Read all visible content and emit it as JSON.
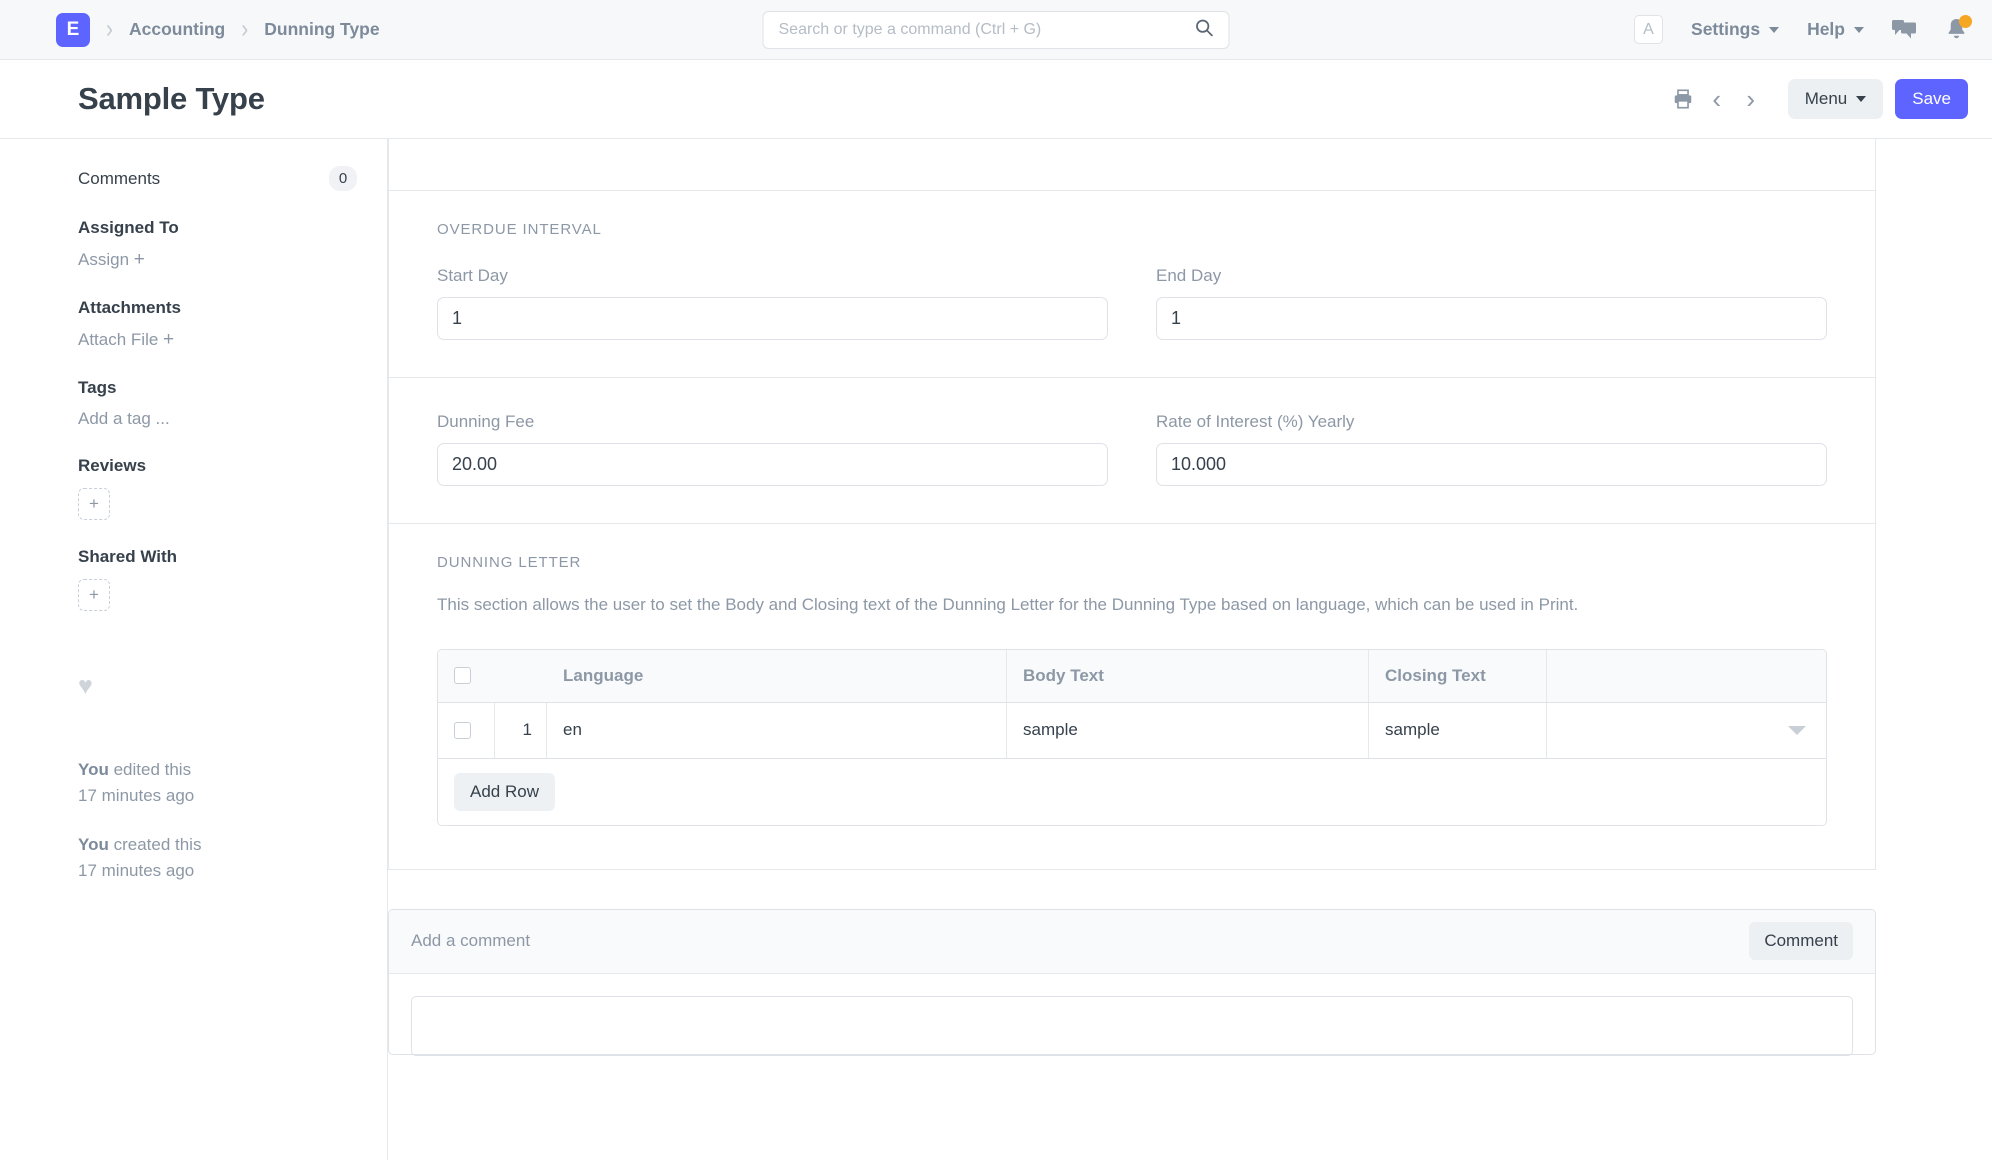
{
  "navbar": {
    "logo_letter": "E",
    "breadcrumbs": [
      "Accounting",
      "Dunning Type"
    ],
    "search_placeholder": "Search or type a command (Ctrl + G)",
    "search_value": "",
    "avatar_letter": "A",
    "settings_label": "Settings",
    "help_label": "Help"
  },
  "titlebar": {
    "title": "Sample Type",
    "menu_label": "Menu",
    "save_label": "Save"
  },
  "sidebar": {
    "comments_label": "Comments",
    "comments_count": "0",
    "assigned_to_label": "Assigned To",
    "assign_label": "Assign",
    "assign_plus": "+",
    "attachments_label": "Attachments",
    "attach_file_label": "Attach File",
    "attach_plus": "+",
    "tags_label": "Tags",
    "add_tag_label": "Add a tag ...",
    "reviews_label": "Reviews",
    "reviews_add": "+",
    "shared_with_label": "Shared With",
    "shared_add": "+",
    "activity": [
      {
        "who": "You",
        "what": " edited this",
        "when": "17 minutes ago"
      },
      {
        "who": "You",
        "what": " created this",
        "when": "17 minutes ago"
      }
    ]
  },
  "form": {
    "overdue_interval": {
      "section_label": "OVERDUE INTERVAL",
      "start_day_label": "Start Day",
      "start_day_value": "1",
      "end_day_label": "End Day",
      "end_day_value": "1"
    },
    "fees": {
      "dunning_fee_label": "Dunning Fee",
      "dunning_fee_value": "20.00",
      "rate_of_interest_label": "Rate of Interest (%) Yearly",
      "rate_of_interest_value": "10.000"
    },
    "dunning_letter": {
      "section_label": "DUNNING LETTER",
      "description": "This section allows the user to set the Body and Closing text of the Dunning Letter for the Dunning Type based on language, which can be used in Print.",
      "grid": {
        "columns": [
          "Language",
          "Body Text",
          "Closing Text"
        ],
        "rows": [
          {
            "index": "1",
            "language": "en",
            "body_text": "sample",
            "closing_text": "sample"
          }
        ],
        "add_row_label": "Add Row"
      }
    }
  },
  "comment_box": {
    "placeholder": "Add a comment",
    "button_label": "Comment"
  }
}
